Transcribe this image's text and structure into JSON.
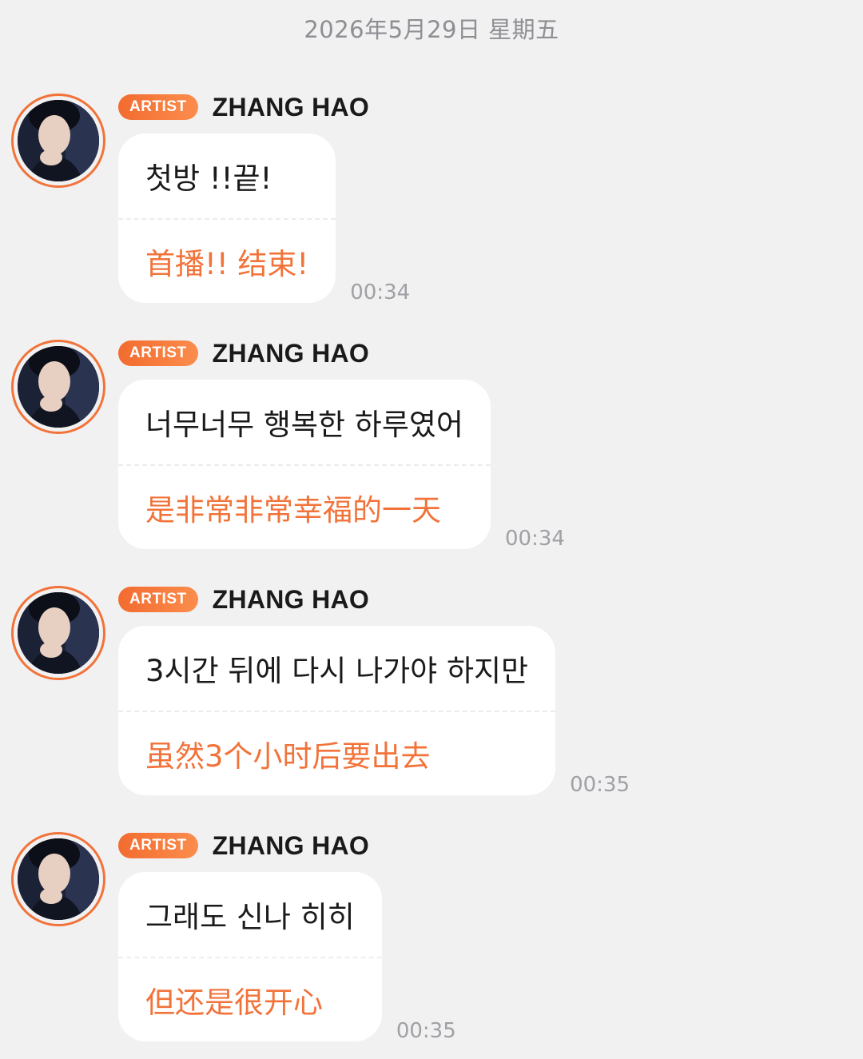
{
  "date_header": "2026年5月29日 星期五",
  "colors": {
    "background": "#f1f1f2",
    "accent": "#f2733a",
    "bubble": "#ffffff",
    "timestamp": "#a0a0a5"
  },
  "messages": [
    {
      "avatar_icon": "profile-photo",
      "badge": "ARTIST",
      "sender": "ZHANG HAO",
      "original": "첫방 !!끝!",
      "translation": "首播!! 结束!",
      "time": "00:34"
    },
    {
      "avatar_icon": "profile-photo",
      "badge": "ARTIST",
      "sender": "ZHANG HAO",
      "original": "너무너무 행복한 하루였어",
      "translation": "是非常非常幸福的一天",
      "time": "00:34"
    },
    {
      "avatar_icon": "profile-photo",
      "badge": "ARTIST",
      "sender": "ZHANG HAO",
      "original": "3시간 뒤에 다시 나가야 하지만",
      "translation": "虽然3个小时后要出去",
      "time": "00:35"
    },
    {
      "avatar_icon": "profile-photo",
      "badge": "ARTIST",
      "sender": "ZHANG HAO",
      "original": "그래도 신나 히히",
      "translation": "但还是很开心",
      "time": "00:35"
    }
  ]
}
